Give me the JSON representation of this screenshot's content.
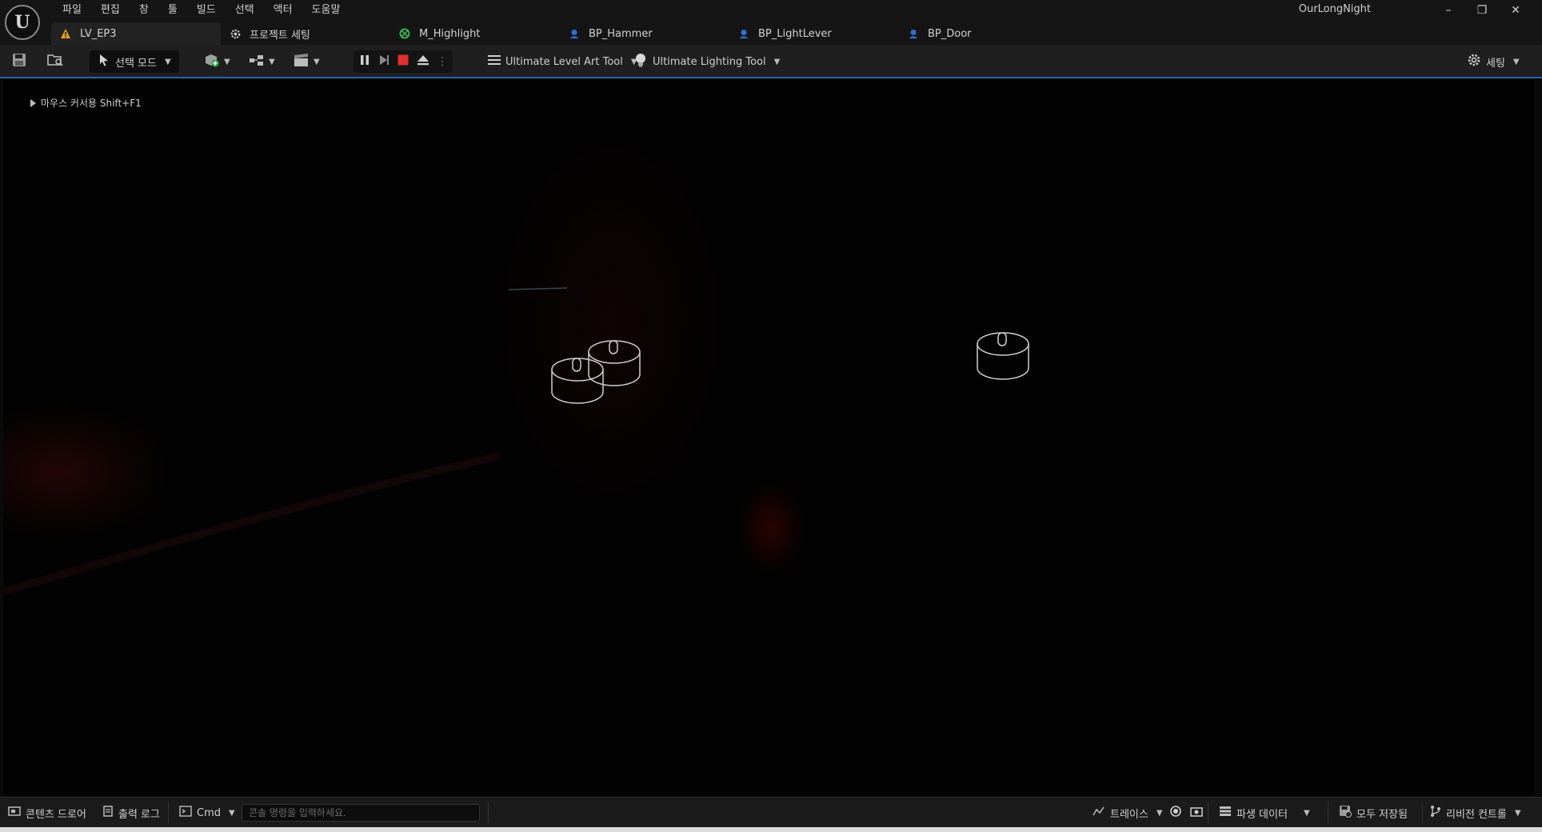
{
  "app": {
    "logo_text": "U",
    "project_name": "OurLongNight"
  },
  "menu": [
    "파일",
    "편집",
    "창",
    "툴",
    "빌드",
    "선택",
    "액터",
    "도움말"
  ],
  "window_controls": {
    "minimize": "–",
    "restore": "❐",
    "close": "✕"
  },
  "tabs": [
    {
      "label": "LV_EP3",
      "icon": "level-icon",
      "color": "#e8a020"
    },
    {
      "label": "프로젝트 세팅",
      "icon": "settings-gear-icon",
      "color": "#cfcfcf"
    },
    {
      "label": "M_Highlight",
      "icon": "material-icon",
      "color": "#3cb050"
    },
    {
      "label": "BP_Hammer",
      "icon": "blueprint-icon",
      "color": "#2f6fd0"
    },
    {
      "label": "BP_LightLever",
      "icon": "blueprint-icon",
      "color": "#2f6fd0"
    },
    {
      "label": "BP_Door",
      "icon": "blueprint-icon",
      "color": "#2f6fd0"
    }
  ],
  "toolbar": {
    "mode_label": "선택 모드",
    "art_tool_label": "Ultimate Level Art Tool",
    "lighting_tool_label": "Ultimate Lighting Tool",
    "settings_label": "세팅",
    "stop_color": "#e03030"
  },
  "viewport": {
    "hint": "마우스 커서용 Shift+F1"
  },
  "statusbar": {
    "content_drawer": "콘텐츠 드로어",
    "output_log": "출력 로그",
    "cmd": "Cmd",
    "cmd_placeholder": "콘솔 명령을 입력하세요.",
    "trace": "트레이스",
    "derived_data": "파생 데이터",
    "all_saved": "모두 저장됨",
    "revision_control": "리비전 컨트롤"
  }
}
